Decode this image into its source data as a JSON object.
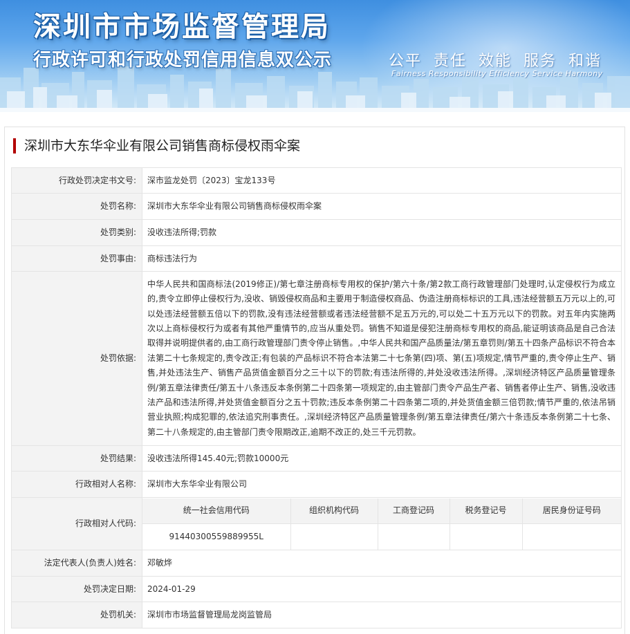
{
  "banner": {
    "title": "深圳市市场监督管理局",
    "subtitle": "行政许可和行政处罚信用信息双公示",
    "values_cn": "公平 责任 效能 服务 和谐",
    "values_en": "Fairness Responsibility Efficiency Service Harmony"
  },
  "case_title": "深圳市大东华伞业有限公司销售商标侵权雨伞案",
  "rows": {
    "decision_no": {
      "label": "行政处罚决定书文号:",
      "value": "深市监龙处罚〔2023〕宝龙133号"
    },
    "penalty_name": {
      "label": "处罚名称:",
      "value": "深圳市大东华伞业有限公司销售商标侵权雨伞案"
    },
    "penalty_type": {
      "label": "处罚类别:",
      "value": "没收违法所得;罚款"
    },
    "penalty_reason": {
      "label": "处罚事由:",
      "value": "商标违法行为"
    },
    "penalty_basis": {
      "label": "处罚依据:",
      "value": "中华人民共和国商标法(2019修正)/第七章注册商标专用权的保护/第六十条/第2款工商行政管理部门处理时,认定侵权行为成立的,责令立即停止侵权行为,没收、销毁侵权商品和主要用于制造侵权商品、伪造注册商标标识的工具,违法经营额五万元以上的,可以处违法经营额五倍以下的罚款,没有违法经营额或者违法经营额不足五万元的,可以处二十五万元以下的罚款。对五年内实施两次以上商标侵权行为或者有其他严重情节的,应当从重处罚。销售不知道是侵犯注册商标专用权的商品,能证明该商品是自己合法取得并说明提供者的,由工商行政管理部门责令停止销售。,中华人民共和国产品质量法/第五章罚则/第五十四条产品标识不符合本法第二十七条规定的,责令改正;有包装的产品标识不符合本法第二十七条第(四)项、第(五)项规定,情节严重的,责令停止生产、销售,并处违法生产、销售产品货值金额百分之三十以下的罚款;有违法所得的,并处没收违法所得。,深圳经济特区产品质量管理条例/第五章法律责任/第五十八条违反本条例第二十四条第一项规定的,由主管部门责令产品生产者、销售者停止生产、销售,没收违法产品和违法所得,并处货值金额百分之五十罚款;违反本条例第二十四条第二项的,并处货值金额三倍罚款;情节严重的,依法吊销营业执照;构成犯罪的,依法追究刑事责任。,深圳经济特区产品质量管理条例/第五章法律责任/第六十条违反本条例第二十七条、第二十八条规定的,由主管部门责令限期改正,逾期不改正的,处三千元罚款。"
    },
    "penalty_result": {
      "label": "处罚结果:",
      "value": "没收违法所得145.40元;罚款10000元"
    },
    "party_name": {
      "label": "行政相对人名称:",
      "value": "深圳市大东华伞业有限公司"
    },
    "party_code": {
      "label": "行政相对人代码:",
      "headers": [
        "统一社会信用代码",
        "组织机构代码",
        "工商登记码",
        "税务登记号",
        "居民身份证号码"
      ],
      "values": [
        "91440300559889955L",
        "",
        "",
        "",
        ""
      ]
    },
    "legal_rep": {
      "label": "法定代表人(负责人)姓名:",
      "value": "邓敏烨"
    },
    "decision_date": {
      "label": "处罚决定日期:",
      "value": "2024-01-29"
    },
    "authority": {
      "label": "处罚机关:",
      "value": "深圳市市场监督管理局龙岗监管局"
    }
  }
}
